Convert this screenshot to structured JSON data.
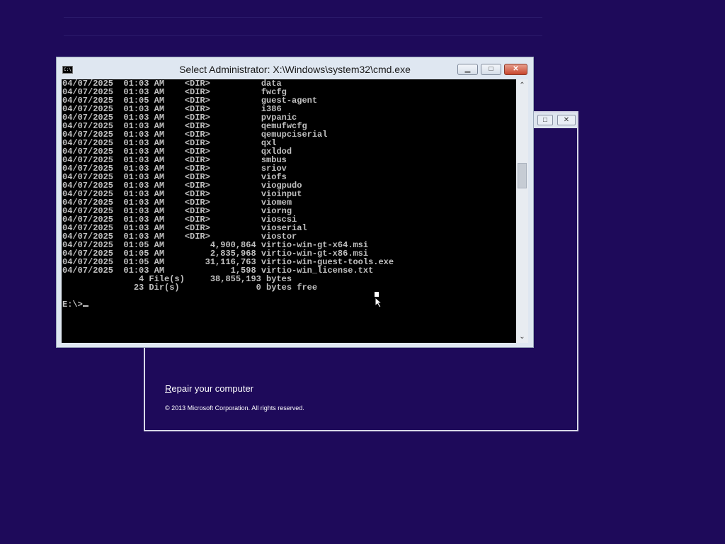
{
  "setup_window": {
    "repair_link_accesskey": "R",
    "repair_link_rest": "epair your computer",
    "copyright": "© 2013 Microsoft Corporation. All rights reserved.",
    "restore_glyph": "□",
    "close_glyph": "✕"
  },
  "cmd_window": {
    "title": "Select Administrator: X:\\Windows\\system32\\cmd.exe",
    "icon_text": "C:\\",
    "minimize_glyph": "▁",
    "maximize_glyph": "□",
    "close_glyph": "✕",
    "scroll_up_glyph": "⌃",
    "scroll_down_glyph": "⌄",
    "console_lines": [
      "04/07/2025  01:03 AM    <DIR>          data",
      "04/07/2025  01:03 AM    <DIR>          fwcfg",
      "04/07/2025  01:05 AM    <DIR>          guest-agent",
      "04/07/2025  01:03 AM    <DIR>          i386",
      "04/07/2025  01:03 AM    <DIR>          pvpanic",
      "04/07/2025  01:03 AM    <DIR>          qemufwcfg",
      "04/07/2025  01:03 AM    <DIR>          qemupciserial",
      "04/07/2025  01:03 AM    <DIR>          qxl",
      "04/07/2025  01:03 AM    <DIR>          qxldod",
      "04/07/2025  01:03 AM    <DIR>          smbus",
      "04/07/2025  01:03 AM    <DIR>          sriov",
      "04/07/2025  01:03 AM    <DIR>          viofs",
      "04/07/2025  01:03 AM    <DIR>          viogpudo",
      "04/07/2025  01:03 AM    <DIR>          vioinput",
      "04/07/2025  01:03 AM    <DIR>          viomem",
      "04/07/2025  01:03 AM    <DIR>          viorng",
      "04/07/2025  01:03 AM    <DIR>          vioscsi",
      "04/07/2025  01:03 AM    <DIR>          vioserial",
      "04/07/2025  01:03 AM    <DIR>          viostor",
      "04/07/2025  01:05 AM         4,900,864 virtio-win-gt-x64.msi",
      "04/07/2025  01:05 AM         2,835,968 virtio-win-gt-x86.msi",
      "04/07/2025  01:05 AM        31,116,763 virtio-win-guest-tools.exe",
      "04/07/2025  01:03 AM             1,598 virtio-win_license.txt",
      "               4 File(s)     38,855,193 bytes",
      "              23 Dir(s)               0 bytes free",
      ""
    ],
    "prompt": "E:\\>"
  }
}
